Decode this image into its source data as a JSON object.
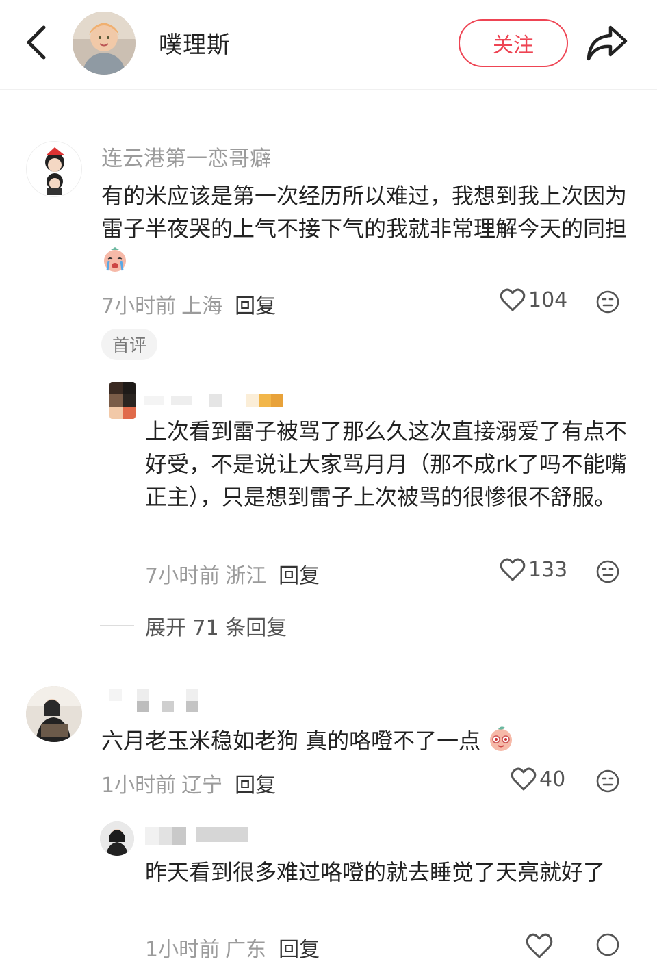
{
  "header": {
    "author_name": "噗理斯",
    "follow_label": "关注"
  },
  "comments": [
    {
      "nickname": "连云港第一恋哥癖",
      "text": "有的米应该是第一次经历所以难过，我想到我上次因为雷子半夜哭的上气不接下气的我就非常理解今天的同担",
      "time": "7小时前",
      "location": "上海",
      "reply_label": "回复",
      "likes": "104",
      "badge": "首评",
      "replies": [
        {
          "text": "上次看到雷子被骂了那么久这次直接溺爱了有点不好受，不是说让大家骂月月（那不成rk了吗不能嘴正主），只是想到雷子上次被骂的很惨很不舒服。",
          "time": "7小时前",
          "location": "浙江",
          "reply_label": "回复",
          "likes": "133"
        }
      ],
      "expand_label": "展开 71 条回复"
    },
    {
      "text": "六月老玉米稳如老狗 真的咯噔不了一点",
      "time": "1小时前",
      "location": "辽宁",
      "reply_label": "回复",
      "likes": "40",
      "replies": [
        {
          "text": "昨天看到很多难过咯噔的就去睡觉了天亮就好了",
          "time": "1小时前",
          "location": "广东",
          "reply_label": "回复"
        }
      ]
    }
  ],
  "colors": {
    "accent": "#ee4453",
    "muted": "#9b9b9b"
  },
  "icons": [
    "back-arrow-icon",
    "share-icon",
    "heart-icon",
    "dislike-face-icon",
    "crying-emoji-icon",
    "peach-emoji-icon"
  ]
}
